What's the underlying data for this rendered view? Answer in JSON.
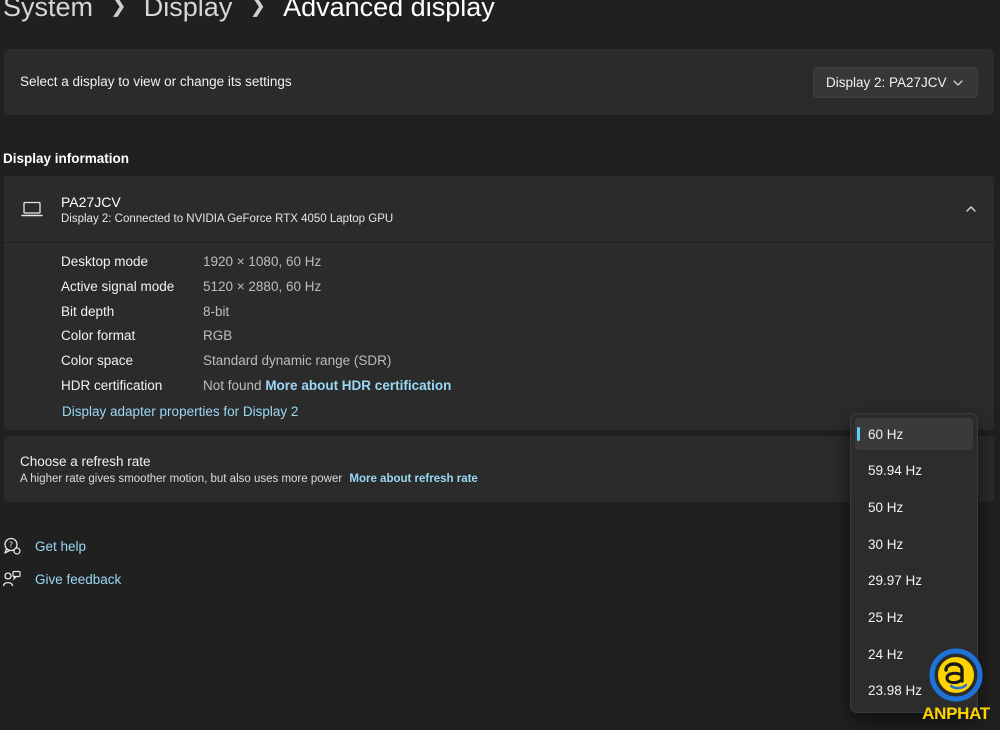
{
  "breadcrumb": [
    {
      "label": "System"
    },
    {
      "label": "Display"
    },
    {
      "label": "Advanced display"
    }
  ],
  "display_select": {
    "label": "Select a display to view or change its settings",
    "selected": "Display 2: PA27JCV"
  },
  "display_info": {
    "section_title": "Display information",
    "name": "PA27JCV",
    "connection": "Display 2: Connected to NVIDIA GeForce RTX 4050 Laptop GPU",
    "rows": [
      {
        "key": "Desktop mode",
        "value": "1920 × 1080, 60 Hz"
      },
      {
        "key": "Active signal mode",
        "value": "5120 × 2880, 60 Hz"
      },
      {
        "key": "Bit depth",
        "value": "8-bit"
      },
      {
        "key": "Color format",
        "value": "RGB"
      },
      {
        "key": "Color space",
        "value": "Standard dynamic range (SDR)"
      },
      {
        "key": "HDR certification",
        "value": "Not found",
        "link": "More about HDR certification"
      }
    ],
    "adapter_link": "Display adapter properties for Display 2"
  },
  "refresh_rate": {
    "title": "Choose a refresh rate",
    "description": "A higher rate gives smoother motion, but also uses more power",
    "link": "More about refresh rate",
    "options": [
      "60 Hz",
      "59.94 Hz",
      "50 Hz",
      "30 Hz",
      "29.97 Hz",
      "25 Hz",
      "24 Hz",
      "23.98 Hz"
    ],
    "selected_index": 0
  },
  "help": {
    "get_help": "Get help",
    "give_feedback": "Give feedback"
  },
  "watermark": {
    "brand": "ANPHAT"
  },
  "colors": {
    "background": "#202020",
    "card": "#2b2b2b",
    "accent_link": "#9ad8f5",
    "accent_indicator": "#60cdff",
    "brand_yellow": "#ffd400",
    "brand_blue": "#1e73d8"
  }
}
